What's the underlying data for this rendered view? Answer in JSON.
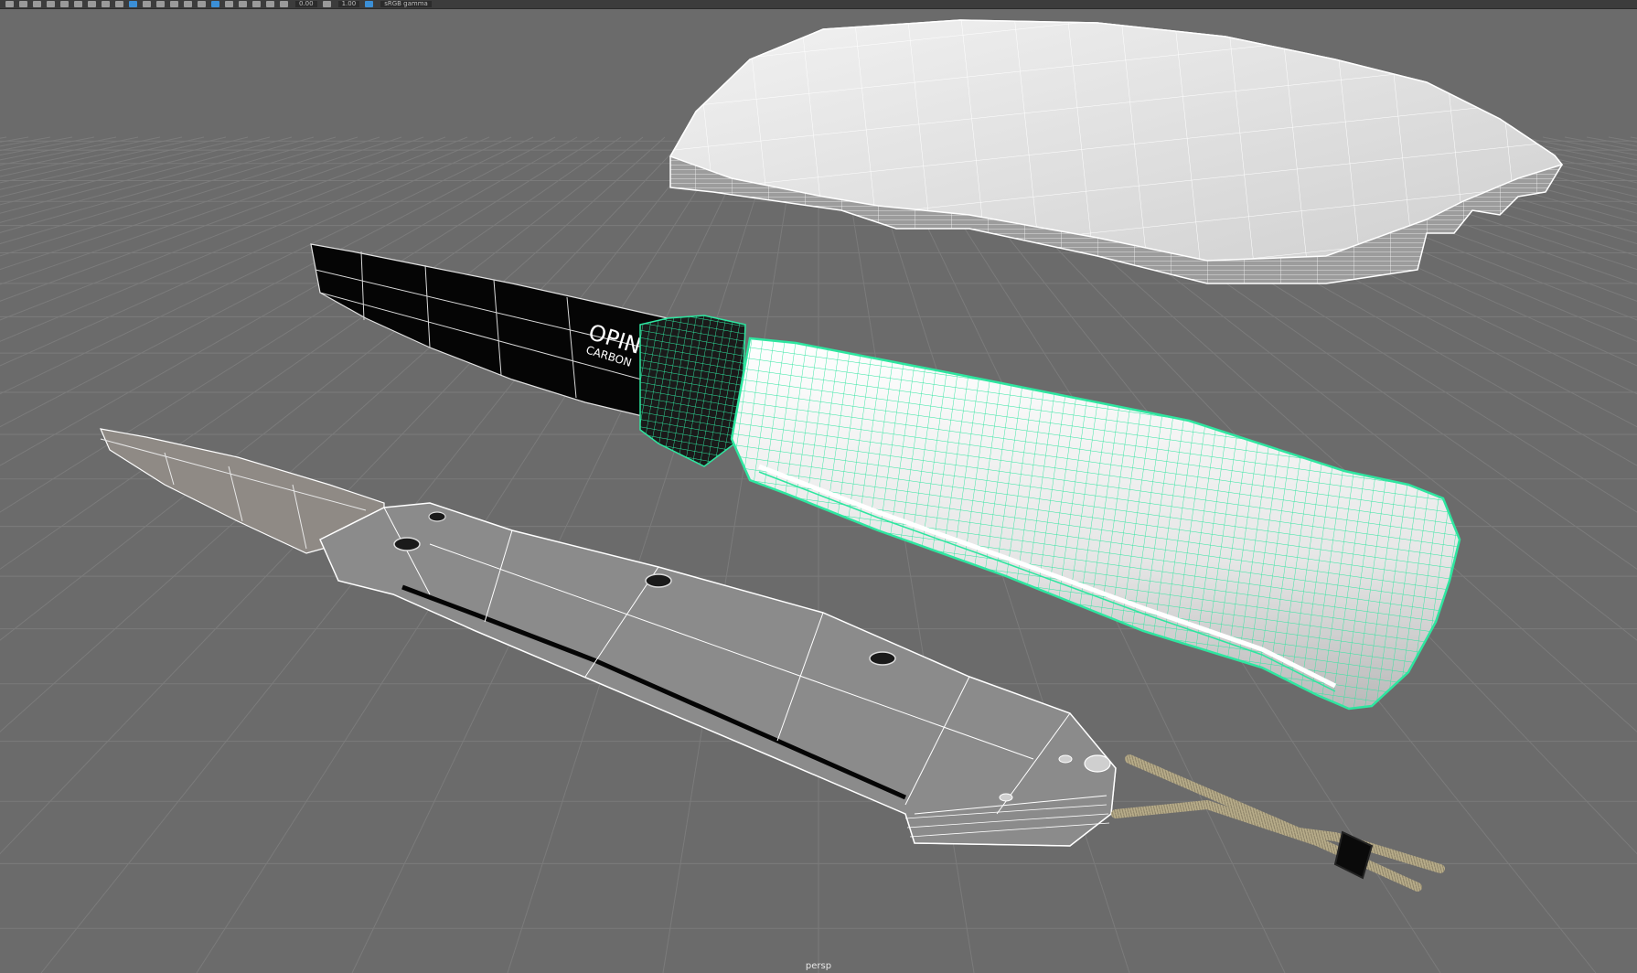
{
  "toolbar": {
    "fields": [
      {
        "id": "near-clip",
        "value": "0.00"
      },
      {
        "id": "far-clip",
        "value": "1.00"
      }
    ],
    "color_space": {
      "label": "sRGB gamma"
    }
  },
  "viewport": {
    "camera": "persp",
    "colors": {
      "background": "#6b6b6b",
      "grid": "#7b7b7b",
      "selection_wireframe": "#2ee6a0",
      "wireframe": "#ffffff"
    }
  },
  "scene": {
    "blade_logo": {
      "line1": "OPINE",
      "line2": "CARBON"
    },
    "objects": [
      {
        "id": "cushion",
        "icon": "cloth-mesh"
      },
      {
        "id": "opinel-knife",
        "icon": "knife-mesh",
        "selected": true
      },
      {
        "id": "folding-knife",
        "icon": "knife-mesh"
      },
      {
        "id": "lanyard",
        "icon": "rope-mesh"
      }
    ]
  }
}
